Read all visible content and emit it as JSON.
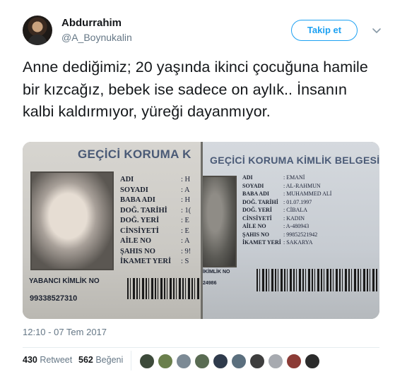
{
  "tweet": {
    "display_name": "Abdurrahim",
    "handle": "@A_Boynukalin",
    "follow_label": "Takip et",
    "text": "Anne dediğimiz; 20 yaşında ikinci çocuğuna hamile bir kızcağız, bebek ise sadece on aylık.. İnsanın kalbi kaldırmıyor, yüreği dayanmıyor.",
    "timestamp": "12:10 - 07 Tem 2017"
  },
  "stats": {
    "retweets": "430",
    "retweet_label": "Retweet",
    "likes": "562",
    "like_label": "Beğeni"
  },
  "media": {
    "card_left": {
      "title": "GEÇİCİ KORUMA K",
      "fields": [
        {
          "label": "ADI",
          "value": "H"
        },
        {
          "label": "SOYADI",
          "value": "A"
        },
        {
          "label": "BABA ADI",
          "value": "H"
        },
        {
          "label": "DOĞ. TARİHİ",
          "value": "1("
        },
        {
          "label": "DOĞ. YERİ",
          "value": "E"
        },
        {
          "label": "CİNSİYETİ",
          "value": "E"
        },
        {
          "label": "AİLE NO",
          "value": "A"
        },
        {
          "label": "ŞAHIS NO",
          "value": "9!"
        },
        {
          "label": "İKAMET YERİ",
          "value": "S"
        }
      ],
      "footer_label": "YABANCI KİMLİK NO",
      "footer_number": "99338527310"
    },
    "card_right": {
      "title": "GEÇİCİ KORUMA KİMLİK BELGESİ",
      "fields": [
        {
          "label": "ADI",
          "value": "EMANİ"
        },
        {
          "label": "SOYADI",
          "value": "AL-RAHMUN"
        },
        {
          "label": "BABA ADI",
          "value": "MUHAMMED ALİ"
        },
        {
          "label": "DOĞ. TARİHİ",
          "value": "01.07.1997"
        },
        {
          "label": "DOĞ. YERİ",
          "value": "CİBALA"
        },
        {
          "label": "CİNSİYETİ",
          "value": "KADIN"
        },
        {
          "label": "AİLE NO",
          "value": "A-480943"
        },
        {
          "label": "ŞAHIS NO",
          "value": "99852521942"
        },
        {
          "label": "İKAMET YERİ",
          "value": "SAKARYA"
        }
      ],
      "footer_label": "İKİMLİK NO",
      "footer_number": "24986"
    }
  },
  "icons": {
    "caret": "chevron-down-icon"
  },
  "colors": {
    "accent": "#1da1f2",
    "text": "#14171a",
    "muted": "#657786"
  },
  "likers": [
    {
      "name": "liker-1",
      "color": "#3d4a3a"
    },
    {
      "name": "liker-2",
      "color": "#6a7f4c"
    },
    {
      "name": "liker-3",
      "color": "#7c8a95"
    },
    {
      "name": "liker-4",
      "color": "#596b52"
    },
    {
      "name": "liker-5",
      "color": "#2f3b4c"
    },
    {
      "name": "liker-6",
      "color": "#5b6f7e"
    },
    {
      "name": "liker-7",
      "color": "#3e3e3e"
    },
    {
      "name": "liker-8",
      "color": "#a7aab0"
    },
    {
      "name": "liker-9",
      "color": "#8c3b36"
    },
    {
      "name": "liker-10",
      "color": "#2b2b2b"
    }
  ]
}
